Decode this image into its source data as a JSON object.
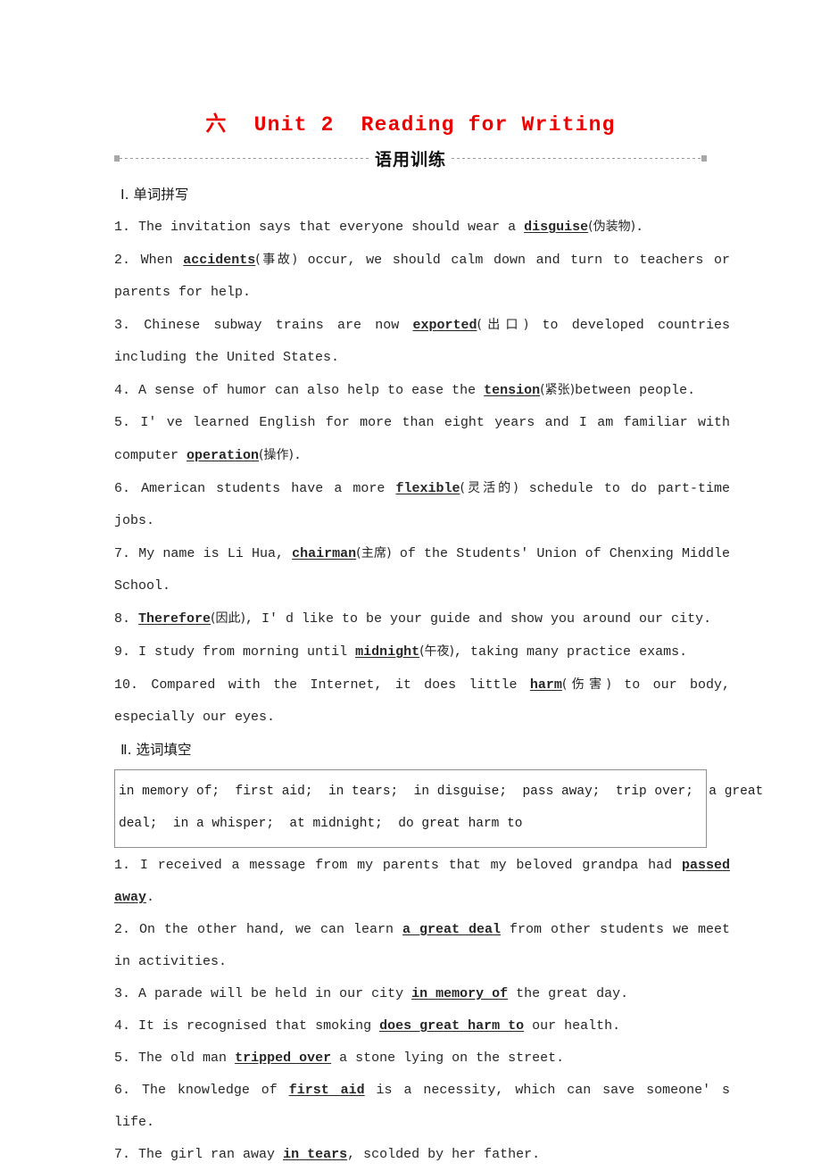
{
  "title": {
    "index": "六",
    "text": "Unit 2  Reading for Writing",
    "color": "#ee0000",
    "full": "六  Unit 2  Reading for Writing"
  },
  "banner": {
    "label": "语用训练",
    "rule_color": "#9a9a9a"
  },
  "sections": [
    {
      "heading": "Ⅰ. 单词拼写",
      "items": [
        {
          "number": "1.",
          "before": "The invitation says that everyone should wear a ",
          "answer": "disguise",
          "gloss": "(伪装物)",
          "after": "."
        },
        {
          "number": "2.",
          "before": "When ",
          "answer": "accidents",
          "gloss": "(事故)",
          "after": " occur, we should calm down and turn to teachers or parents for help."
        },
        {
          "number": "3.",
          "before": "Chinese subway trains are now ",
          "answer": "exported",
          "gloss": "(出口)",
          "after": " to developed countries including the United States."
        },
        {
          "number": "4.",
          "before": "A sense of humor can also help to ease the ",
          "answer": "tension",
          "gloss": "(紧张)",
          "after": "between people."
        },
        {
          "number": "5.",
          "before": "I' ve learned English for more than eight years and I am familiar with computer ",
          "answer": "operation",
          "gloss": "(操作)",
          "after": "."
        },
        {
          "number": "6.",
          "before": "American students have a more ",
          "answer": "flexible",
          "gloss": "(灵活的)",
          "after": " schedule to do part-time jobs."
        },
        {
          "number": "7.",
          "before": "My name is Li Hua, ",
          "answer": "chairman",
          "gloss": "(主席)",
          "after": " of the Students'  Union of Chenxing Middle School."
        },
        {
          "number": "8.",
          "before": "",
          "answer": "Therefore",
          "gloss": "(因此)",
          "after": ", I' d like to be your guide and show you around our city."
        },
        {
          "number": "9.",
          "before": "I study from morning until ",
          "answer": "midnight",
          "gloss": "(午夜)",
          "after": ",  taking many practice exams."
        },
        {
          "number": "10.",
          "before": "Compared with the Internet,  it does little ",
          "answer": "harm",
          "gloss": "(伤害)",
          "after": " to our body,  especially our eyes."
        }
      ]
    },
    {
      "heading": "Ⅱ. 选词填空",
      "wordbank": {
        "line1": "in memory of;  first aid;  in tears;  in disguise;  pass away;  trip over;  a great",
        "line2": "deal;  in a whisper;  at midnight;  do great harm to"
      },
      "items": [
        {
          "number": "1.",
          "before": "I received a message from my parents that my beloved grandpa had ",
          "answer": "passed away",
          "gloss": "",
          "after": "."
        },
        {
          "number": "2.",
          "before": "On the other hand, we can learn ",
          "answer": "a great deal",
          "gloss": "",
          "after": " from other students we meet in activities."
        },
        {
          "number": "3.",
          "before": "A parade will be held in our city ",
          "answer": "in memory of",
          "gloss": "",
          "after": " the great day."
        },
        {
          "number": "4.",
          "before": "It is recognised that smoking ",
          "answer": "does great harm to",
          "gloss": "",
          "after": " our health."
        },
        {
          "number": "5.",
          "before": "The old man ",
          "answer": "tripped over",
          "gloss": "",
          "after": " a stone lying on the street."
        },
        {
          "number": "6.",
          "before": "The knowledge of ",
          "answer": "first aid",
          "gloss": "",
          "after": " is a necessity,  which can save someone' s life."
        },
        {
          "number": "7.",
          "before": "The girl ran away ",
          "answer": "in tears",
          "gloss": "",
          "after": ", scolded by her father."
        }
      ]
    }
  ]
}
